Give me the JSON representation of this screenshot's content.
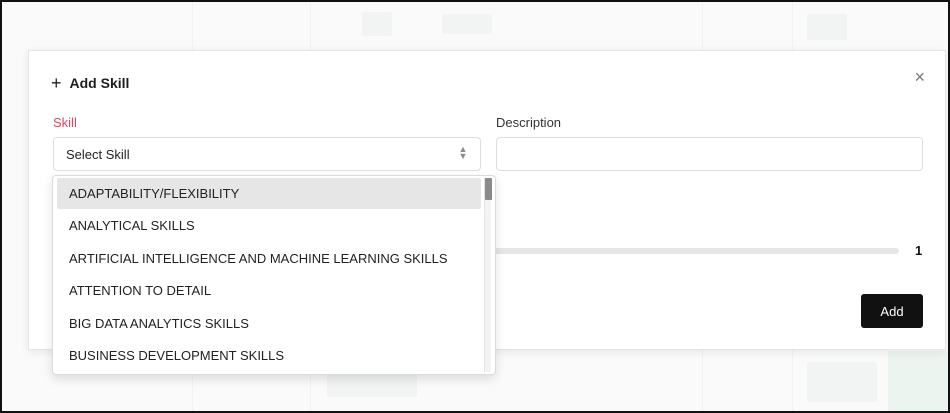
{
  "modal": {
    "title": "Add Skill",
    "plus_icon": "+",
    "close_icon": "×",
    "skill_label": "Skill",
    "skill_placeholder": "Select Skill",
    "description_label": "Description",
    "description_value": "",
    "slider_value": "1",
    "add_button_label": "Add"
  },
  "dropdown": {
    "options": [
      "ADAPTABILITY/FLEXIBILITY",
      "ANALYTICAL SKILLS",
      "ARTIFICIAL INTELLIGENCE AND MACHINE LEARNING SKILLS",
      "ATTENTION TO DETAIL",
      "BIG DATA ANALYTICS SKILLS",
      "BUSINESS DEVELOPMENT SKILLS"
    ],
    "highlighted_index": 0
  },
  "colors": {
    "required_label": "#e0465f",
    "primary_button": "#111111",
    "highlight_row": "#e6e6e6"
  },
  "icons": {
    "plus": "plus-icon",
    "close": "close-icon",
    "select_arrows": "chevron-up-down-icon"
  }
}
